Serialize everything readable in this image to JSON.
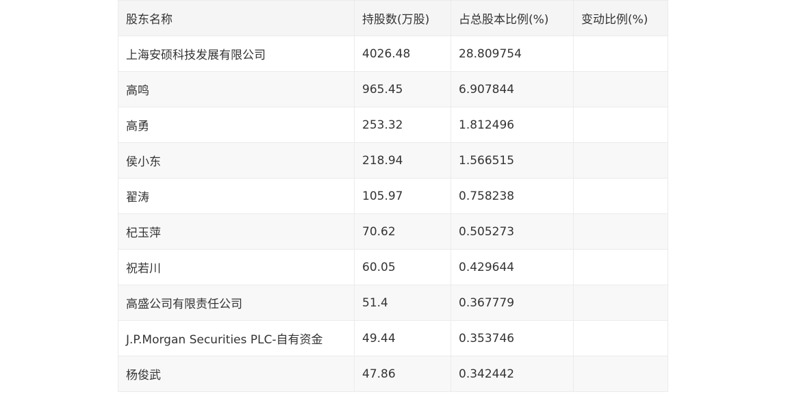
{
  "table": {
    "headers": [
      "股东名称",
      "持股数(万股)",
      "占总股本比例(%)",
      "变动比例(%)"
    ],
    "rows": [
      [
        "上海安硕科技发展有限公司",
        "4026.48",
        "28.809754",
        ""
      ],
      [
        "高鸣",
        "965.45",
        "6.907844",
        ""
      ],
      [
        "高勇",
        "253.32",
        "1.812496",
        ""
      ],
      [
        "侯小东",
        "218.94",
        "1.566515",
        ""
      ],
      [
        "翟涛",
        "105.97",
        "0.758238",
        ""
      ],
      [
        "杞玉萍",
        "70.62",
        "0.505273",
        ""
      ],
      [
        "祝若川",
        "60.05",
        "0.429644",
        ""
      ],
      [
        "高盛公司有限责任公司",
        "51.4",
        "0.367779",
        ""
      ],
      [
        "J.P.Morgan Securities PLC-自有资金",
        "49.44",
        "0.353746",
        ""
      ],
      [
        "杨俊武",
        "47.86",
        "0.342442",
        ""
      ]
    ]
  },
  "colors": {
    "header_bg": "#f5f5f5",
    "row_alt_bg": "#f8f8f8",
    "border": "#ebebeb",
    "text": "#333333"
  }
}
